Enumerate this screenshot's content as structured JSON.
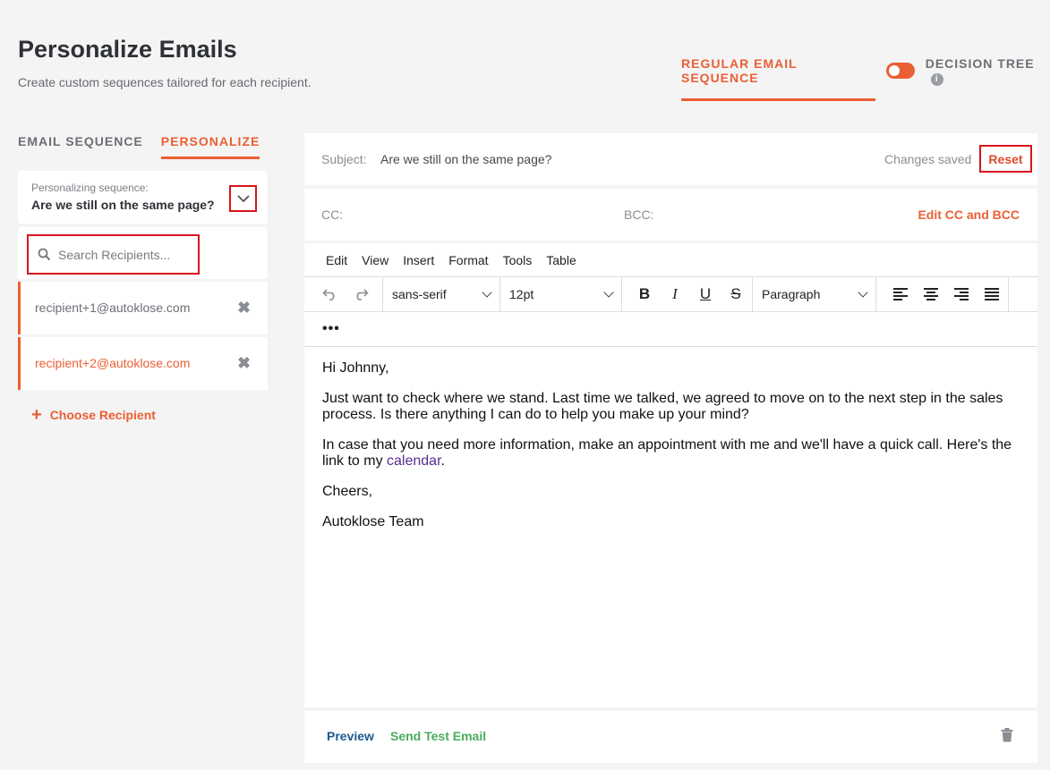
{
  "header": {
    "title": "Personalize Emails",
    "subtitle": "Create custom sequences tailored for each recipient.",
    "mode_regular": "REGULAR EMAIL SEQUENCE",
    "mode_tree": "DECISION TREE",
    "info_glyph": "i"
  },
  "left_tabs": {
    "email_sequence": "EMAIL SEQUENCE",
    "personalize": "PERSONALIZE"
  },
  "sequence": {
    "label": "Personalizing sequence:",
    "name": "Are we still on the same page?"
  },
  "search": {
    "placeholder": "Search Recipients..."
  },
  "recipients": [
    {
      "email": "recipient+1@autoklose.com",
      "color": "#6b6f75"
    },
    {
      "email": "recipient+2@autoklose.com",
      "color": "#ea5f33"
    }
  ],
  "remove_glyph": "✖",
  "choose_recipient": {
    "icon": "+",
    "label": "Choose Recipient"
  },
  "subject": {
    "label": "Subject:",
    "value": "Are we still on the same page?",
    "status": "Changes saved",
    "reset": "Reset"
  },
  "cc": {
    "cc_label": "CC:",
    "bcc_label": "BCC:",
    "edit": "Edit CC and BCC"
  },
  "editor": {
    "menu": [
      "Edit",
      "View",
      "Insert",
      "Format",
      "Tools",
      "Table"
    ],
    "font_family": "sans-serif",
    "font_size": "12pt",
    "block_format": "Paragraph",
    "bold": "B",
    "italic": "I",
    "underline": "U",
    "strike": "S",
    "undo": "↶",
    "redo": "↷",
    "more": "•••",
    "body": {
      "greeting": "Hi Johnny,",
      "para1": "Just want to check where we stand. Last time we talked, we agreed to move on to the next step in the sales process. Is there anything I can do to help you make up your mind?",
      "para2_pre": "In case that you need more information, make an appointment with me and we'll have a quick call. Here's the link to my ",
      "para2_link": "calendar",
      "para2_post": ".",
      "closing": "Cheers,",
      "signature": "Autoklose Team"
    }
  },
  "footer": {
    "preview": "Preview",
    "send_test": "Send Test Email"
  },
  "colors": {
    "accent": "#ea5f33",
    "highlight_border": "#d8151b",
    "preview": "#1e5a8c",
    "send_test": "#4aad5c"
  }
}
